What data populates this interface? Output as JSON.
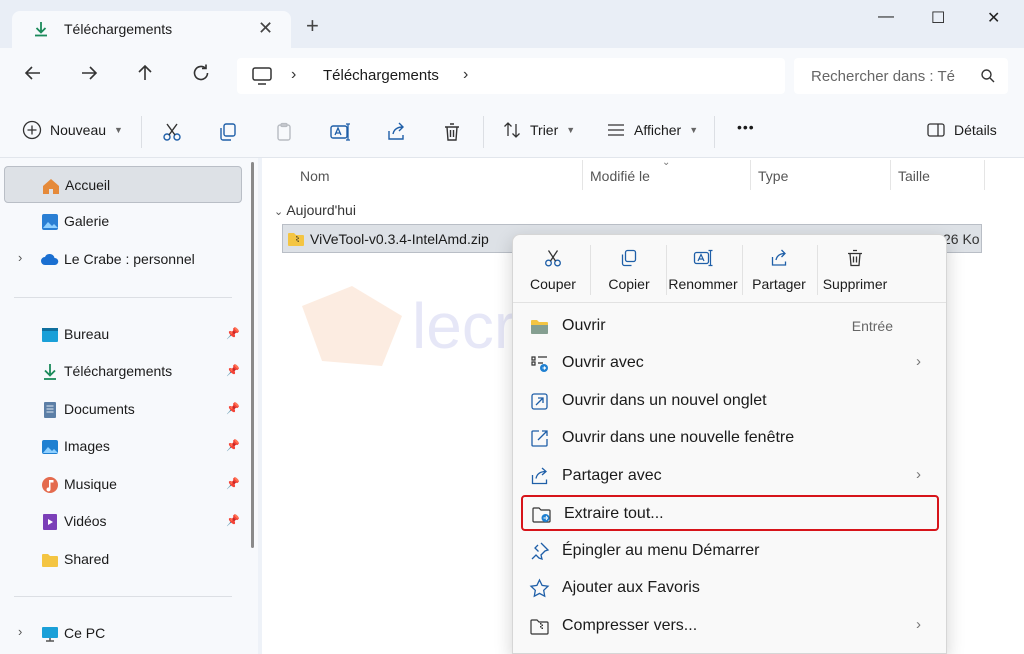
{
  "tab": {
    "title": "Téléchargements",
    "close": "✕"
  },
  "newtab": "+",
  "window": {
    "minimize": "—",
    "maximize": "☐",
    "close": "✕"
  },
  "address": {
    "chevron": "›",
    "location": "Téléchargements"
  },
  "search": {
    "placeholder": "Rechercher dans : Té"
  },
  "commands": {
    "new_label": "Nouveau",
    "sort_label": "Trier",
    "view_label": "Afficher",
    "more_label": "•••",
    "details_label": "Détails"
  },
  "sidebar": {
    "home": "Accueil",
    "gallery": "Galerie",
    "onedrive": "Le Crabe : personnel",
    "pinned": [
      {
        "label": "Bureau",
        "icon": "desktop-icon"
      },
      {
        "label": "Téléchargements",
        "icon": "download-icon"
      },
      {
        "label": "Documents",
        "icon": "documents-icon"
      },
      {
        "label": "Images",
        "icon": "pictures-icon"
      },
      {
        "label": "Musique",
        "icon": "music-icon"
      },
      {
        "label": "Vidéos",
        "icon": "videos-icon"
      },
      {
        "label": "Shared",
        "icon": "folder-icon"
      }
    ],
    "thispc": "Ce PC"
  },
  "columns": {
    "name": "Nom",
    "modified": "Modifié le",
    "type": "Type",
    "size": "Taille"
  },
  "group": {
    "label": "Aujourd'hui"
  },
  "file": {
    "name": "ViVeTool-v0.3.4-IntelAmd.zip",
    "size": "26 Ko"
  },
  "watermark": {
    "text": "lecrabeinfo"
  },
  "context_menu": {
    "quick_actions": [
      {
        "label": "Couper",
        "icon": "cut-icon"
      },
      {
        "label": "Copier",
        "icon": "copy-icon"
      },
      {
        "label": "Renommer",
        "icon": "rename-icon"
      },
      {
        "label": "Partager",
        "icon": "share-icon"
      },
      {
        "label": "Supprimer",
        "icon": "delete-icon"
      }
    ],
    "items": [
      {
        "label": "Ouvrir",
        "shortcut": "Entrée",
        "icon": "folder-open-icon"
      },
      {
        "label": "Ouvrir avec",
        "submenu": true,
        "icon": "open-with-icon"
      },
      {
        "label": "Ouvrir dans un nouvel onglet",
        "icon": "new-tab-icon"
      },
      {
        "label": "Ouvrir dans une nouvelle fenêtre",
        "icon": "new-window-icon"
      },
      {
        "label": "Partager avec",
        "submenu": true,
        "icon": "share-icon"
      },
      {
        "label": "Extraire tout...",
        "highlighted": true,
        "icon": "extract-icon"
      },
      {
        "label": "Épingler au menu Démarrer",
        "icon": "pin-icon"
      },
      {
        "label": "Ajouter aux Favoris",
        "icon": "star-icon"
      },
      {
        "label": "Compresser vers...",
        "submenu": true,
        "icon": "compress-icon"
      }
    ],
    "submenu_arrow": "›",
    "highlight_color": "#d7141a"
  },
  "colors": {
    "accent": "#0067c0",
    "selection": "#dde1e6",
    "download_green": "#1a8a5a"
  }
}
